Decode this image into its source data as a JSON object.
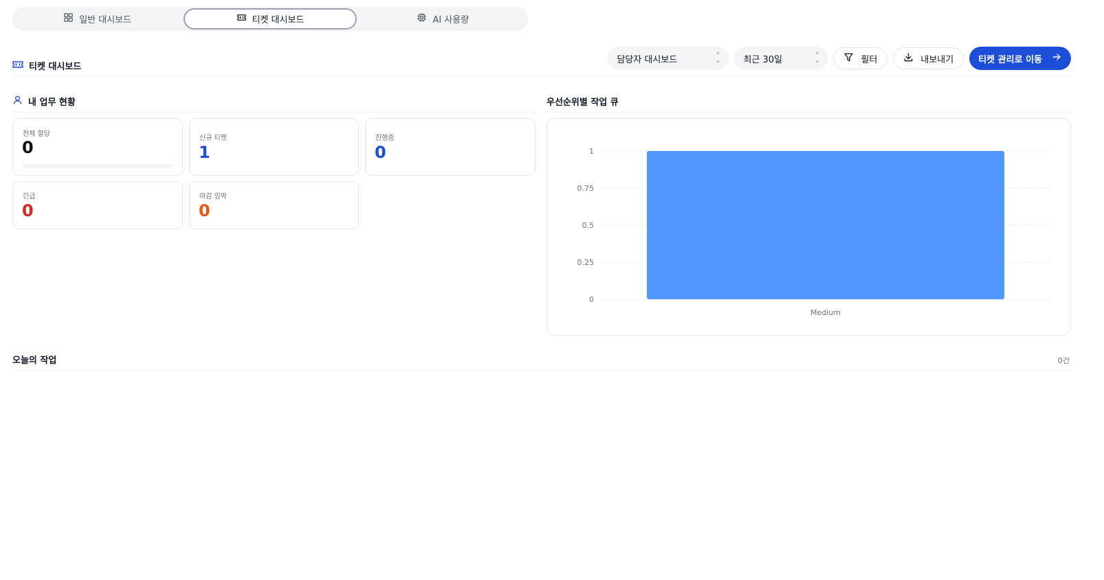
{
  "tabs": [
    {
      "label": "일반 대시보드",
      "icon": "grid-icon",
      "active": false
    },
    {
      "label": "티켓 대시보드",
      "icon": "ticket-icon",
      "active": true
    },
    {
      "label": "AI 사용량",
      "icon": "chip-icon",
      "active": false
    }
  ],
  "header": {
    "title": "티켓 대시보드",
    "owner_select": "담당자 대시보드",
    "period_select": "최근 30일",
    "filter_label": "필터",
    "export_label": "내보내기",
    "go_tickets_label": "티켓 관리로 이동"
  },
  "my_tasks": {
    "title": "내 업무 현황",
    "cards": [
      {
        "label": "전체 할당",
        "value": "0",
        "color": "#111111",
        "progress": 0
      },
      {
        "label": "신규 티켓",
        "value": "1",
        "color": "#1d4ed8"
      },
      {
        "label": "진행중",
        "value": "0",
        "color": "#1d4ed8"
      },
      {
        "label": "긴급",
        "value": "0",
        "color": "#dc2626"
      },
      {
        "label": "마감 임박",
        "value": "0",
        "color": "#ea580c"
      }
    ]
  },
  "priority_queue": {
    "title": "우선순위별 작업 큐"
  },
  "chart_data": {
    "type": "bar",
    "categories": [
      "Medium"
    ],
    "values": [
      1
    ],
    "ylim": [
      0,
      1
    ],
    "yticks": [
      0,
      0.25,
      0.5,
      0.75,
      1
    ],
    "ytick_labels": [
      "0",
      "0.25",
      "0.5",
      "0.75",
      "1"
    ],
    "grid": true,
    "bar_color": "#5196fa"
  },
  "today": {
    "title": "오늘의 작업",
    "count": "0건"
  }
}
